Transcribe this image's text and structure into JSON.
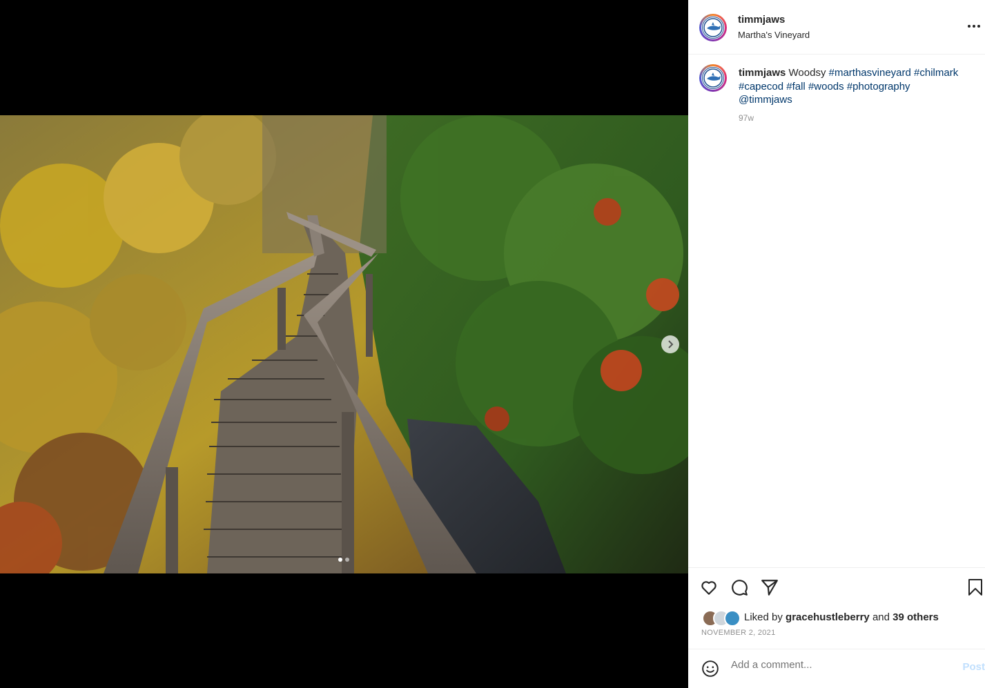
{
  "post": {
    "username": "timmjaws",
    "location": "Martha's Vineyard",
    "more_icon": "more-horizontal-icon",
    "caption": {
      "username": "timmjaws",
      "text": "Woodsy",
      "hashtags": [
        "#marthasvineyard",
        "#chilmark",
        "#capecod",
        "#fall",
        "#woods",
        "#photography"
      ],
      "mention": "@timmjaws"
    },
    "time_ago": "97w",
    "likes": {
      "prefix": "Liked by",
      "user": "gracehustleberry",
      "connector": "and",
      "others": "39 others"
    },
    "date": "NOVEMBER 2, 2021"
  },
  "comment_box": {
    "placeholder": "Add a comment...",
    "post_label": "Post"
  },
  "carousel": {
    "total": 2,
    "current": 1
  },
  "colors": {
    "link": "#00376b",
    "text": "#262626",
    "muted": "#8e8e8e",
    "post_disabled": "#c0dffd"
  }
}
